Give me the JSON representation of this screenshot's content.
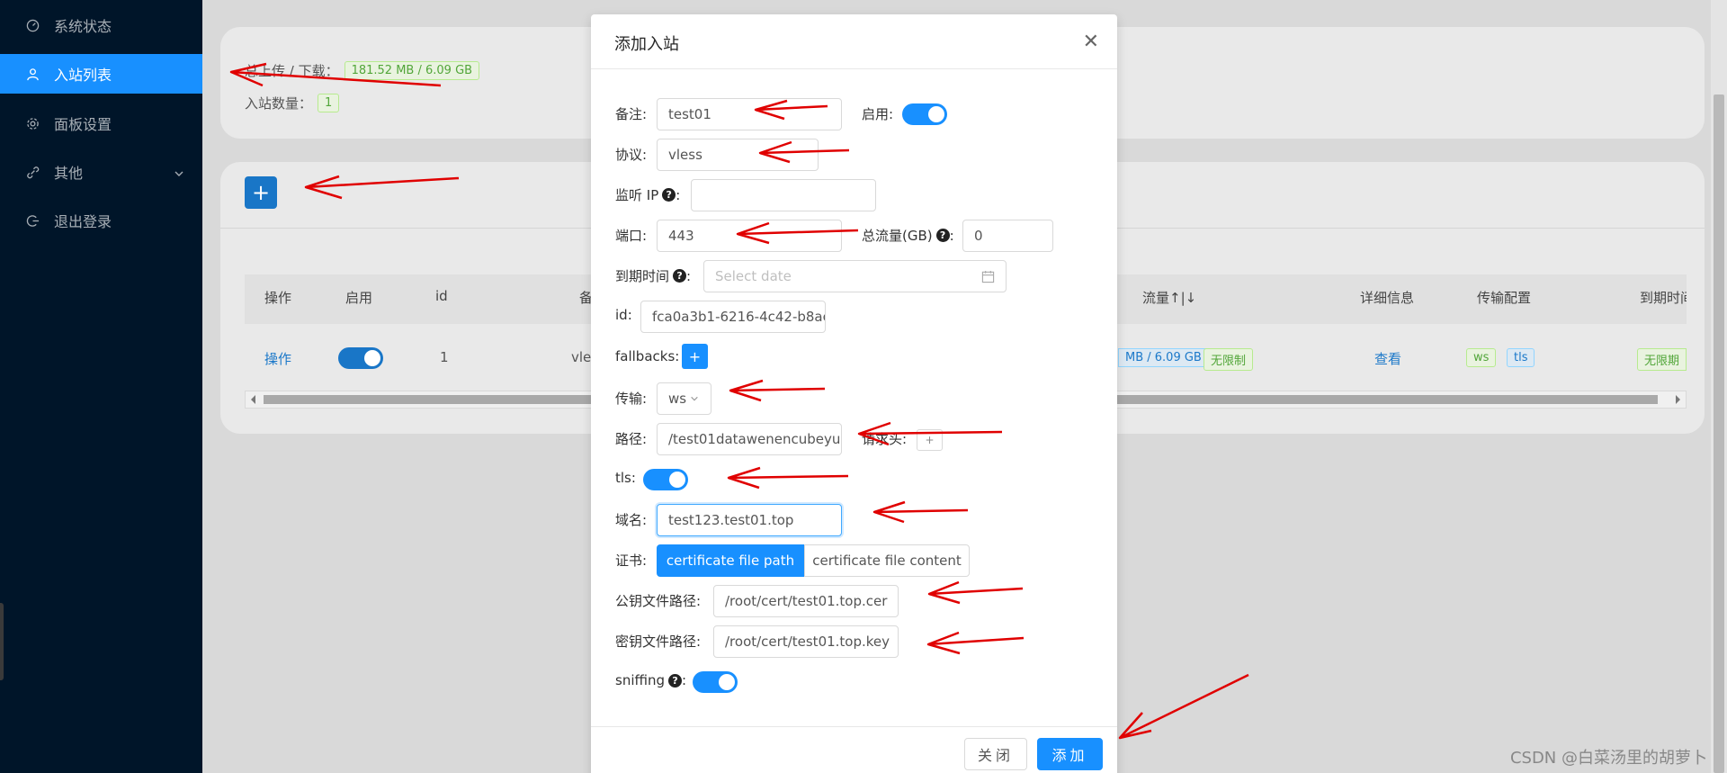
{
  "sidebar": {
    "items": [
      {
        "label": "系统状态",
        "icon": "dashboard-icon"
      },
      {
        "label": "入站列表",
        "icon": "user-icon",
        "active": true
      },
      {
        "label": "面板设置",
        "icon": "gear-icon"
      },
      {
        "label": "其他",
        "icon": "link-icon"
      },
      {
        "label": "退出登录",
        "icon": "logout-icon"
      }
    ]
  },
  "stats": {
    "upload_download_label": "总上传 / 下载：",
    "upload_download_value": "181.52 MB / 6.09 GB",
    "inbound_count_label": "入站数量：",
    "inbound_count_value": "1"
  },
  "add_button_label": "+",
  "table": {
    "headers": {
      "ops": "操作",
      "enable": "启用",
      "id": "id",
      "remark": "备",
      "traffic": "流量↑|↓",
      "detail": "详细信息",
      "transport": "传输配置",
      "expiry": "到期时间"
    },
    "row": {
      "ops": "操作",
      "id": "1",
      "remark": "vle",
      "traffic": "MB / 6.09 GB",
      "traffic_limit": "无限制",
      "detail": "查看",
      "transport_ws": "ws",
      "transport_tls": "tls",
      "expiry": "无限期"
    }
  },
  "modal": {
    "title": "添加入站",
    "close_glyph": "✕",
    "fields": {
      "remark_label": "备注:",
      "remark_value": "test01",
      "enable_label": "启用:",
      "protocol_label": "协议:",
      "protocol_value": "vless",
      "listen_ip_label": "监听 IP",
      "listen_ip_suffix": ":",
      "listen_ip_value": "",
      "port_label": "端口:",
      "port_value": "443",
      "total_traffic_label": "总流量(GB)",
      "total_traffic_suffix": ":",
      "total_traffic_value": "0",
      "expiry_label": "到期时间",
      "expiry_suffix": ":",
      "expiry_placeholder": "Select date",
      "id_label": "id:",
      "id_value": "fca0a3b1-6216-4c42-b8ac",
      "fallbacks_label": "fallbacks:",
      "transport_label": "传输:",
      "transport_value": "ws",
      "path_label": "路径:",
      "path_value": "/test01datawenencubeyu",
      "header_label": "请求头:",
      "tls_label": "tls:",
      "domain_label": "域名:",
      "domain_value": "test123.test01.top",
      "cert_label": "证书:",
      "cert_option_path": "certificate file path",
      "cert_option_content": "certificate file content",
      "pubkey_label": "公钥文件路径:",
      "pubkey_value": "/root/cert/test01.top.cer",
      "privkey_label": "密钥文件路径:",
      "privkey_value": "/root/cert/test01.top.key",
      "sniffing_label": "sniffing",
      "sniffing_suffix": ":"
    },
    "footer": {
      "close_label": "关闭",
      "add_label": "添加"
    }
  },
  "watermark": "CSDN @白菜汤里的胡萝卜",
  "colors": {
    "sidebar_bg": "#001529",
    "primary": "#1890ff",
    "arrow": "#e00000"
  }
}
